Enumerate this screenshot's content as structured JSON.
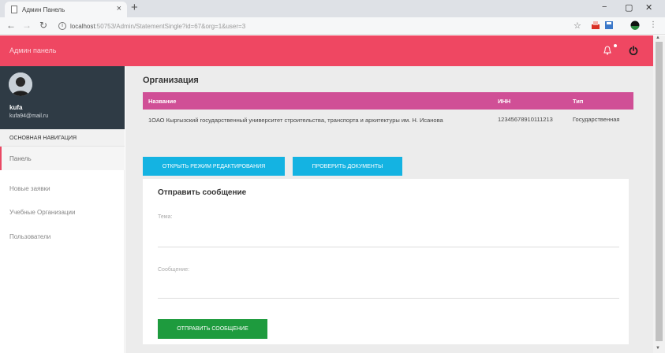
{
  "browser": {
    "tab_title": "Админ Панель",
    "tab_close": "×",
    "new_tab": "+",
    "url_host": "localhost",
    "url_path": ":50753/Admin/StatementSingle?id=67&org=1&user=3",
    "controls": {
      "minimize": "−",
      "maximize": "▢",
      "close": "✕"
    },
    "star": "☆"
  },
  "header": {
    "brand": "Админ панель"
  },
  "user": {
    "name": "kufa",
    "email": "kufa94@mail.ru"
  },
  "sidebar": {
    "heading": "ОСНОВНАЯ НАВИГАЦИЯ",
    "items": [
      {
        "label": "Панель"
      },
      {
        "label": "Новые заявки"
      },
      {
        "label": "Учебные Организации"
      },
      {
        "label": "Пользователи"
      }
    ]
  },
  "organization": {
    "title": "Организация",
    "columns": {
      "name": "Название",
      "inn": "ИНН",
      "type": "Тип"
    },
    "row": {
      "name": "1ОАО Кыргызский государственный университет строительства, транспорта и архитектуры им. Н. Исанова",
      "inn": "12345678910111213",
      "type": "Государственная"
    }
  },
  "actions": {
    "edit_mode": "ОТКРЫТЬ РЕЖИМ РЕДАКТИРОВАНИЯ",
    "check_docs": "ПРОВЕРИТЬ ДОКУМЕНТЫ"
  },
  "message_form": {
    "title": "Отправить сообщение",
    "subject_label": "Тема:",
    "message_label": "Сообщение:",
    "send_label": "ОТПРАВИТЬ СООБЩЕНИЕ"
  },
  "colors": {
    "header": "#ef4762",
    "profile_bg": "#2f3b45",
    "table_header": "#d04f96",
    "primary_button": "#14b3e2",
    "send_button": "#1e9b3e"
  }
}
